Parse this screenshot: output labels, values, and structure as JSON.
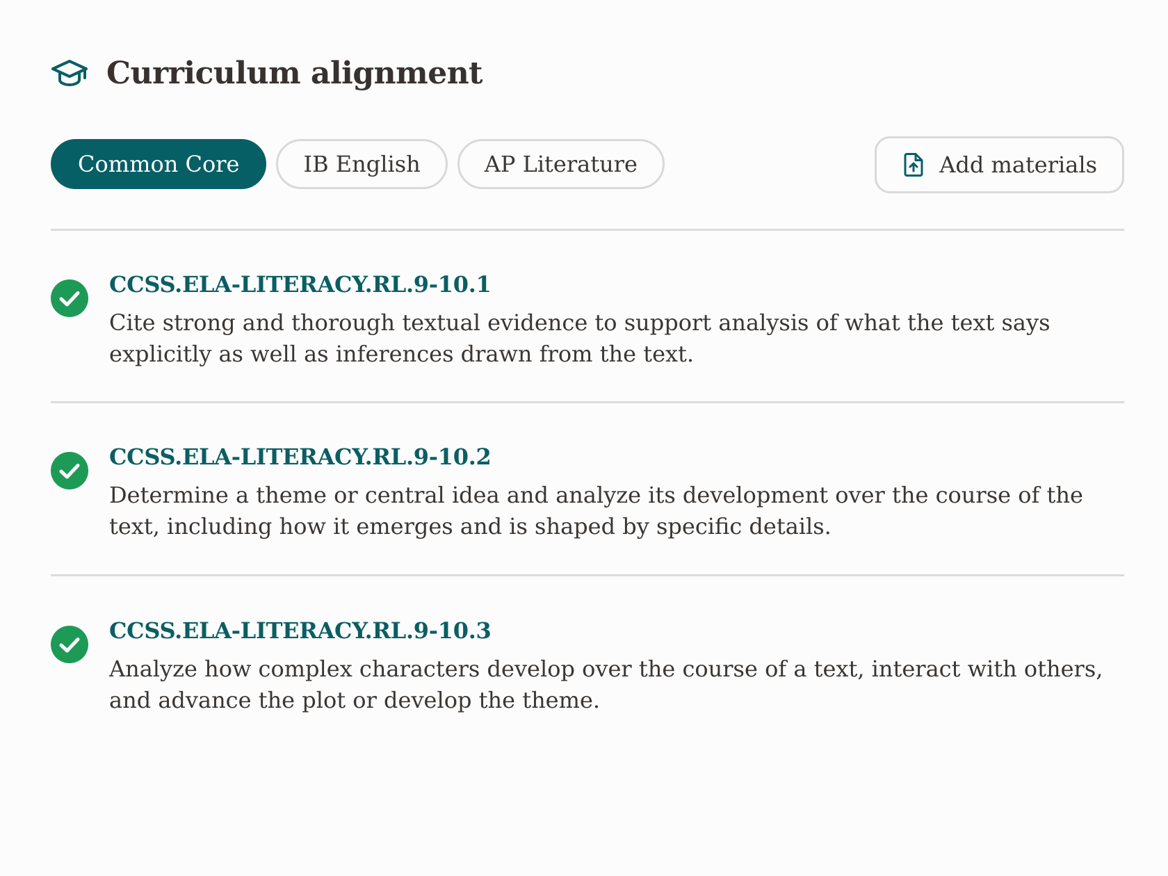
{
  "header": {
    "title": "Curriculum alignment",
    "icon": "graduation-cap-icon"
  },
  "tabs": [
    {
      "label": "Common Core",
      "active": true
    },
    {
      "label": "IB English",
      "active": false
    },
    {
      "label": "AP Literature",
      "active": false
    }
  ],
  "actions": {
    "add_materials_label": "Add materials",
    "add_materials_icon": "file-upload-icon"
  },
  "standards": [
    {
      "code": "CCSS.ELA-LITERACY.RL.9-10.1",
      "description": "Cite strong and thorough textual evidence to support analysis of what the text says explicitly as well as inferences drawn from the text.",
      "status": "aligned"
    },
    {
      "code": "CCSS.ELA-LITERACY.RL.9-10.2",
      "description": "Determine a theme or central idea and analyze its development over the course of the text, including how it emerges and is shaped by specific details.",
      "status": "aligned"
    },
    {
      "code": "CCSS.ELA-LITERACY.RL.9-10.3",
      "description": "Analyze how complex characters develop over the course of a text, interact with others, and advance the plot or develop the theme.",
      "status": "aligned"
    }
  ],
  "colors": {
    "accent": "#075f66",
    "check": "#1e9a57",
    "divider": "#dcdcdc",
    "text": "#3a3633"
  }
}
